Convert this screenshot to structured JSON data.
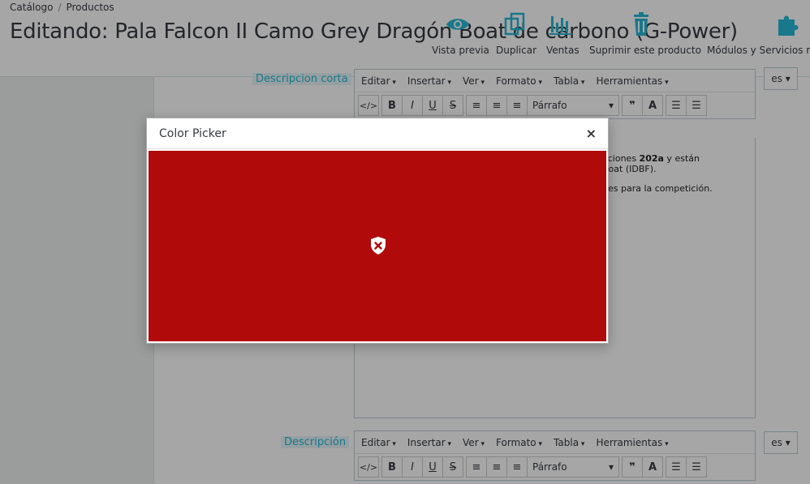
{
  "breadcrumb": {
    "item1": "Catálogo",
    "separator": "/",
    "item2": "Productos"
  },
  "page_title": "Editando: Pala Falcon II Camo Grey Dragón Boat de carbono (G-Power)",
  "toolbar": {
    "preview": "Vista previa",
    "duplicate": "Duplicar",
    "sales": "Ventas",
    "delete": "Suprimir este producto",
    "modules": "Módulos y Servicios rec"
  },
  "short_desc": {
    "label": "Descripcion corta",
    "lang": "es",
    "text_line1_a": "aciones ",
    "text_line1_bold": "202a",
    "text_line1_b": " y están",
    "text_line2": "Boat (IDBF).",
    "text_line3": "nes para la competición."
  },
  "description": {
    "label": "Descripción",
    "lang": "es"
  },
  "editor_menu": [
    "Editar",
    "Insertar",
    "Ver",
    "Formato",
    "Tabla",
    "Herramientas"
  ],
  "format_select": "Párrafo",
  "modal": {
    "title": "Color Picker",
    "close": "×"
  },
  "colors": {
    "error_bg": "#b00a0a",
    "accent": "#25b9d7"
  }
}
